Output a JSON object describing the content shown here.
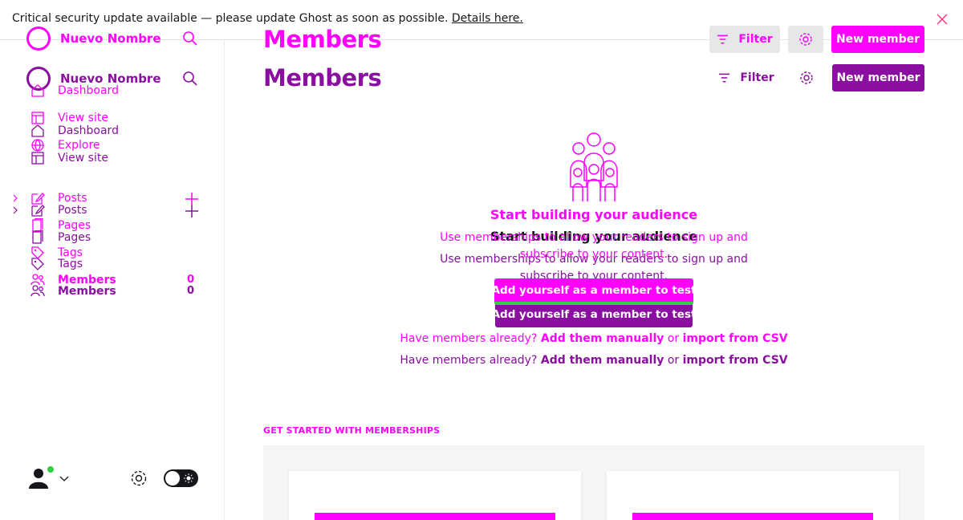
{
  "banner": {
    "message": "Critical security update available — please update Ghost as soon as possible.",
    "link": "Details here."
  },
  "site": {
    "name": "Nuevo Nombre"
  },
  "nav": {
    "dashboard": "Dashboard",
    "view_site": "View site",
    "explore": "Explore",
    "posts": "Posts",
    "pages": "Pages",
    "tags": "Tags",
    "members": "Members",
    "members_count": "0"
  },
  "header": {
    "title": "Members",
    "filter_label": "Filter",
    "new_member_label": "New member"
  },
  "empty_state": {
    "title": "Start building your audience",
    "description": "Use memberships to allow your readers to sign up and subscribe to your content.",
    "cta_label": "Add yourself as a member to test",
    "import_prefix": "Have members already?",
    "import_manual": "Add them manually",
    "import_or": "or",
    "import_csv": "import from CSV"
  },
  "get_started": {
    "label": "GET STARTED WITH MEMBERSHIPS"
  },
  "colors": {
    "accent_purple": "#8a0fa0",
    "overlay_magenta": "#ff00ff",
    "status_online": "#30cf43",
    "gray_button": "#e5e7e8"
  },
  "icons": [
    "search-icon",
    "home-icon",
    "layout-icon",
    "globe-icon",
    "edit-icon",
    "pages-icon",
    "tag-icon",
    "members-icon",
    "plus-icon",
    "filter-icon",
    "gear-icon",
    "close-icon",
    "chevron-right-icon",
    "chevron-down-icon",
    "sun-icon",
    "audience-illustration"
  ]
}
